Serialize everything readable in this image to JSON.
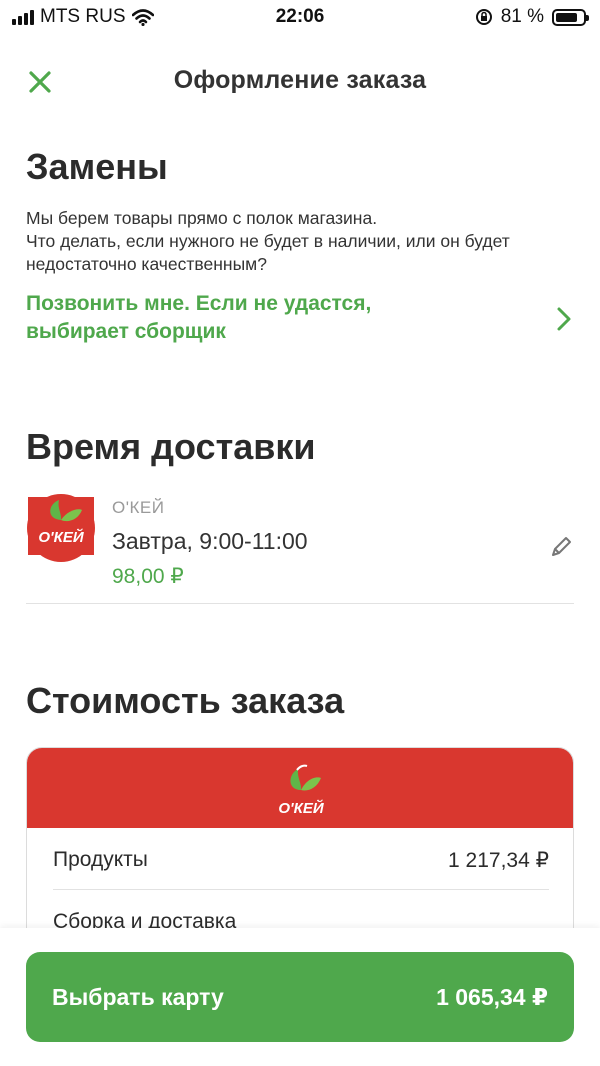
{
  "status_bar": {
    "carrier": "MTS RUS",
    "time": "22:06",
    "battery_percent": "81 %",
    "icons": [
      "signal-icon",
      "wifi-icon",
      "orientation-lock-icon",
      "battery-icon"
    ]
  },
  "nav": {
    "title": "Оформление заказа",
    "close_icon": "close-icon"
  },
  "replacements": {
    "heading": "Замены",
    "description_line1": "Мы берем товары прямо с полок магазина.",
    "description_line2": "Что делать, если нужного не будет в наличии, или он будет недостаточно качественным?",
    "option_line1": "Позвонить мне. Если не удастся,",
    "option_line2": "выбирает сборщик"
  },
  "delivery": {
    "heading": "Время доставки",
    "store_name": "О'КЕЙ",
    "logo_text": "О'КЕЙ",
    "slot": "Завтра, 9:00-11:00",
    "price": "98,00 ₽"
  },
  "cost": {
    "heading": "Стоимость заказа",
    "logo_text": "О'КЕЙ",
    "rows": [
      {
        "label": "Продукты",
        "value": "1 217,34 ₽"
      },
      {
        "label": "Сборка и доставка",
        "value": ""
      }
    ]
  },
  "pay": {
    "label": "Выбрать карту",
    "sum": "1 065,34 ₽"
  },
  "colors": {
    "accent_green": "#4fa84c",
    "brand_red": "#d9372f",
    "text_dark": "#2b2b2b",
    "text_muted": "#9a9a9a"
  }
}
